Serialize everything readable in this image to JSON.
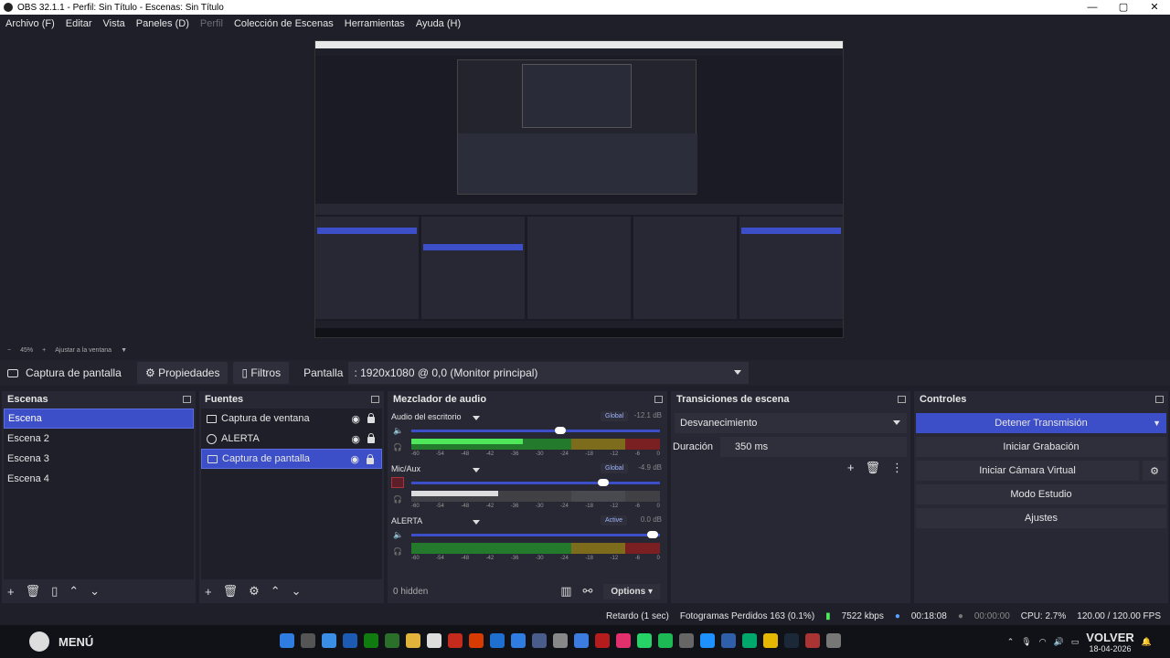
{
  "window": {
    "title": "OBS 32.1.1 - Perfil: Sin Título - Escenas: Sin Título"
  },
  "menu": [
    "Archivo (F)",
    "Editar",
    "Vista",
    "Paneles (D)",
    "Perfil",
    "Colección de Escenas",
    "Herramientas",
    "Ayuda (H)"
  ],
  "zoom": {
    "minus": "−",
    "percent": "45%",
    "plus": "+",
    "fit": "Ajustar a la ventana"
  },
  "source_bar": {
    "current": "Captura de pantalla",
    "properties": "Propiedades",
    "filters": "Filtros",
    "display_label": "Pantalla",
    "display_value": ": 1920x1080 @ 0,0 (Monitor principal)"
  },
  "scenes": {
    "title": "Escenas",
    "items": [
      "Escena",
      "Escena 2",
      "Escena 3",
      "Escena 4"
    ],
    "selected": 0
  },
  "sources": {
    "title": "Fuentes",
    "items": [
      "Captura de ventana",
      "ALERTA",
      "Captura de pantalla"
    ],
    "selected": 2
  },
  "mixer": {
    "title": "Mezclador de audio",
    "channels": [
      {
        "name": "Audio del escritorio",
        "badge": "Global",
        "db": "-12.1 dB",
        "level": 0.6,
        "meter": 0.45
      },
      {
        "name": "Mic/Aux",
        "badge": "Global",
        "db": "-4.9 dB",
        "level": 0.77,
        "meter": 0.35
      },
      {
        "name": "ALERTA",
        "badge": "Active",
        "db": "0.0 dB",
        "level": 0.97,
        "meter": 0.0
      }
    ],
    "scale": [
      "-60",
      "-54",
      "-48",
      "-42",
      "-36",
      "-30",
      "-24",
      "-18",
      "-12",
      "-6",
      "0"
    ],
    "hidden": "0 hidden",
    "options": "Options"
  },
  "transitions": {
    "title": "Transiciones de escena",
    "type": "Desvanecimiento",
    "duration_label": "Duración",
    "duration_value": "350 ms"
  },
  "controls": {
    "title": "Controles",
    "stop_stream": "Detener Transmisión",
    "start_record": "Iniciar Grabación",
    "virtual_cam": "Iniciar Cámara Virtual",
    "studio": "Modo Estudio",
    "settings": "Ajustes"
  },
  "status": {
    "delay": "Retardo (1 sec)",
    "dropped": "Fotogramas Perdidos 163 (0.1%)",
    "kbps": "7522 kbps",
    "stream_time": "00:18:08",
    "rec_time": "00:00:00",
    "cpu": "CPU: 2.7%",
    "fps": "120.00 / 120.00 FPS"
  },
  "taskbar": {
    "menu": "MENÚ",
    "brand": "VOLVER",
    "date": "18-04-2026"
  },
  "colors": {
    "accent": "#3c4ec8",
    "bg": "#1e1f29",
    "panel": "#272833"
  }
}
